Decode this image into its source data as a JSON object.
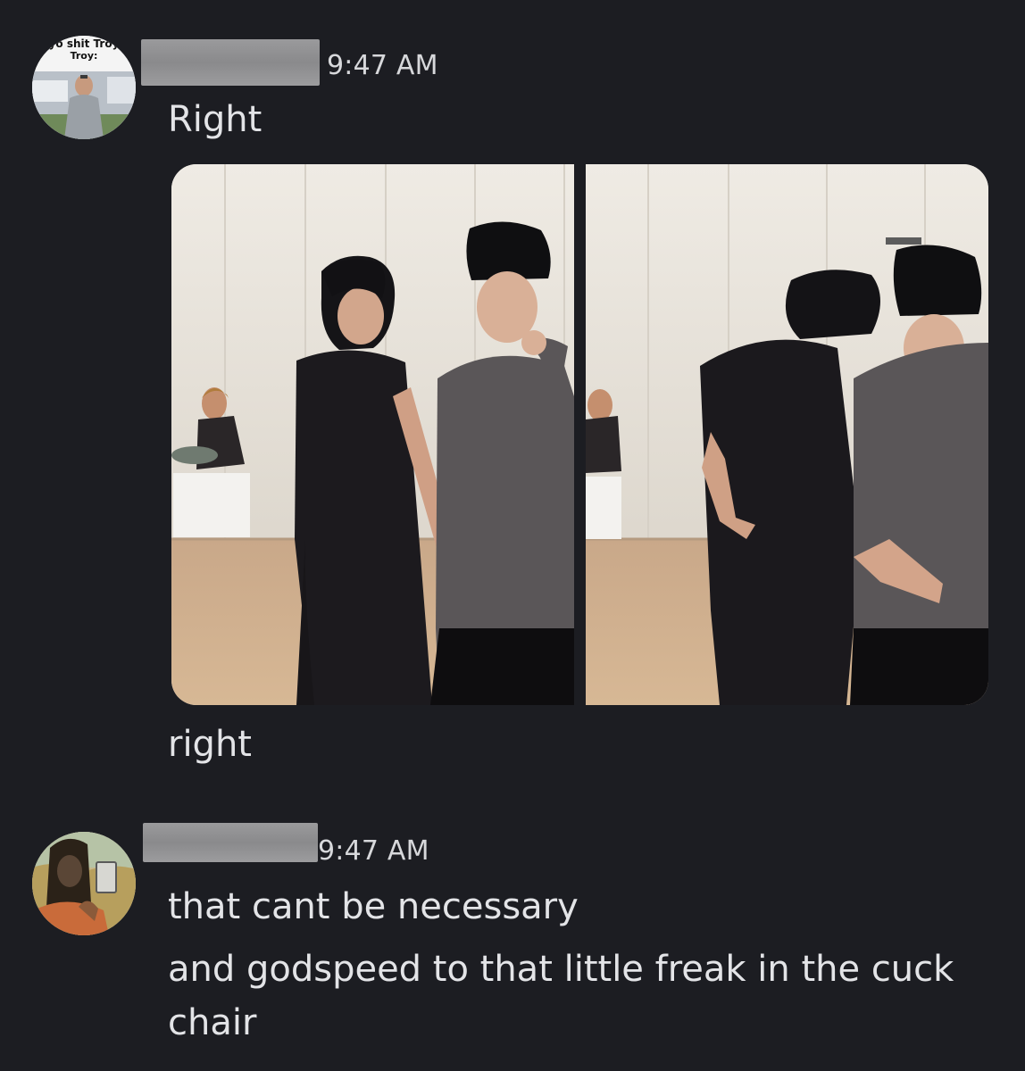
{
  "messages": [
    {
      "timestamp": "9:47 AM",
      "avatar": {
        "caption_line1": "yo shit Troy",
        "caption_line2": "Troy:"
      },
      "lines": [
        "Right",
        "right"
      ],
      "attachments": [
        "photo-left",
        "photo-right"
      ]
    },
    {
      "timestamp": "9:47 AM",
      "lines": [
        "that cant be necessary",
        "and godspeed to that little freak in the cuck",
        "chair"
      ]
    }
  ],
  "colors": {
    "background": "#1c1d22",
    "text": "#e3e4e7",
    "timestamp": "#d7d8db",
    "redaction": "#909092"
  }
}
